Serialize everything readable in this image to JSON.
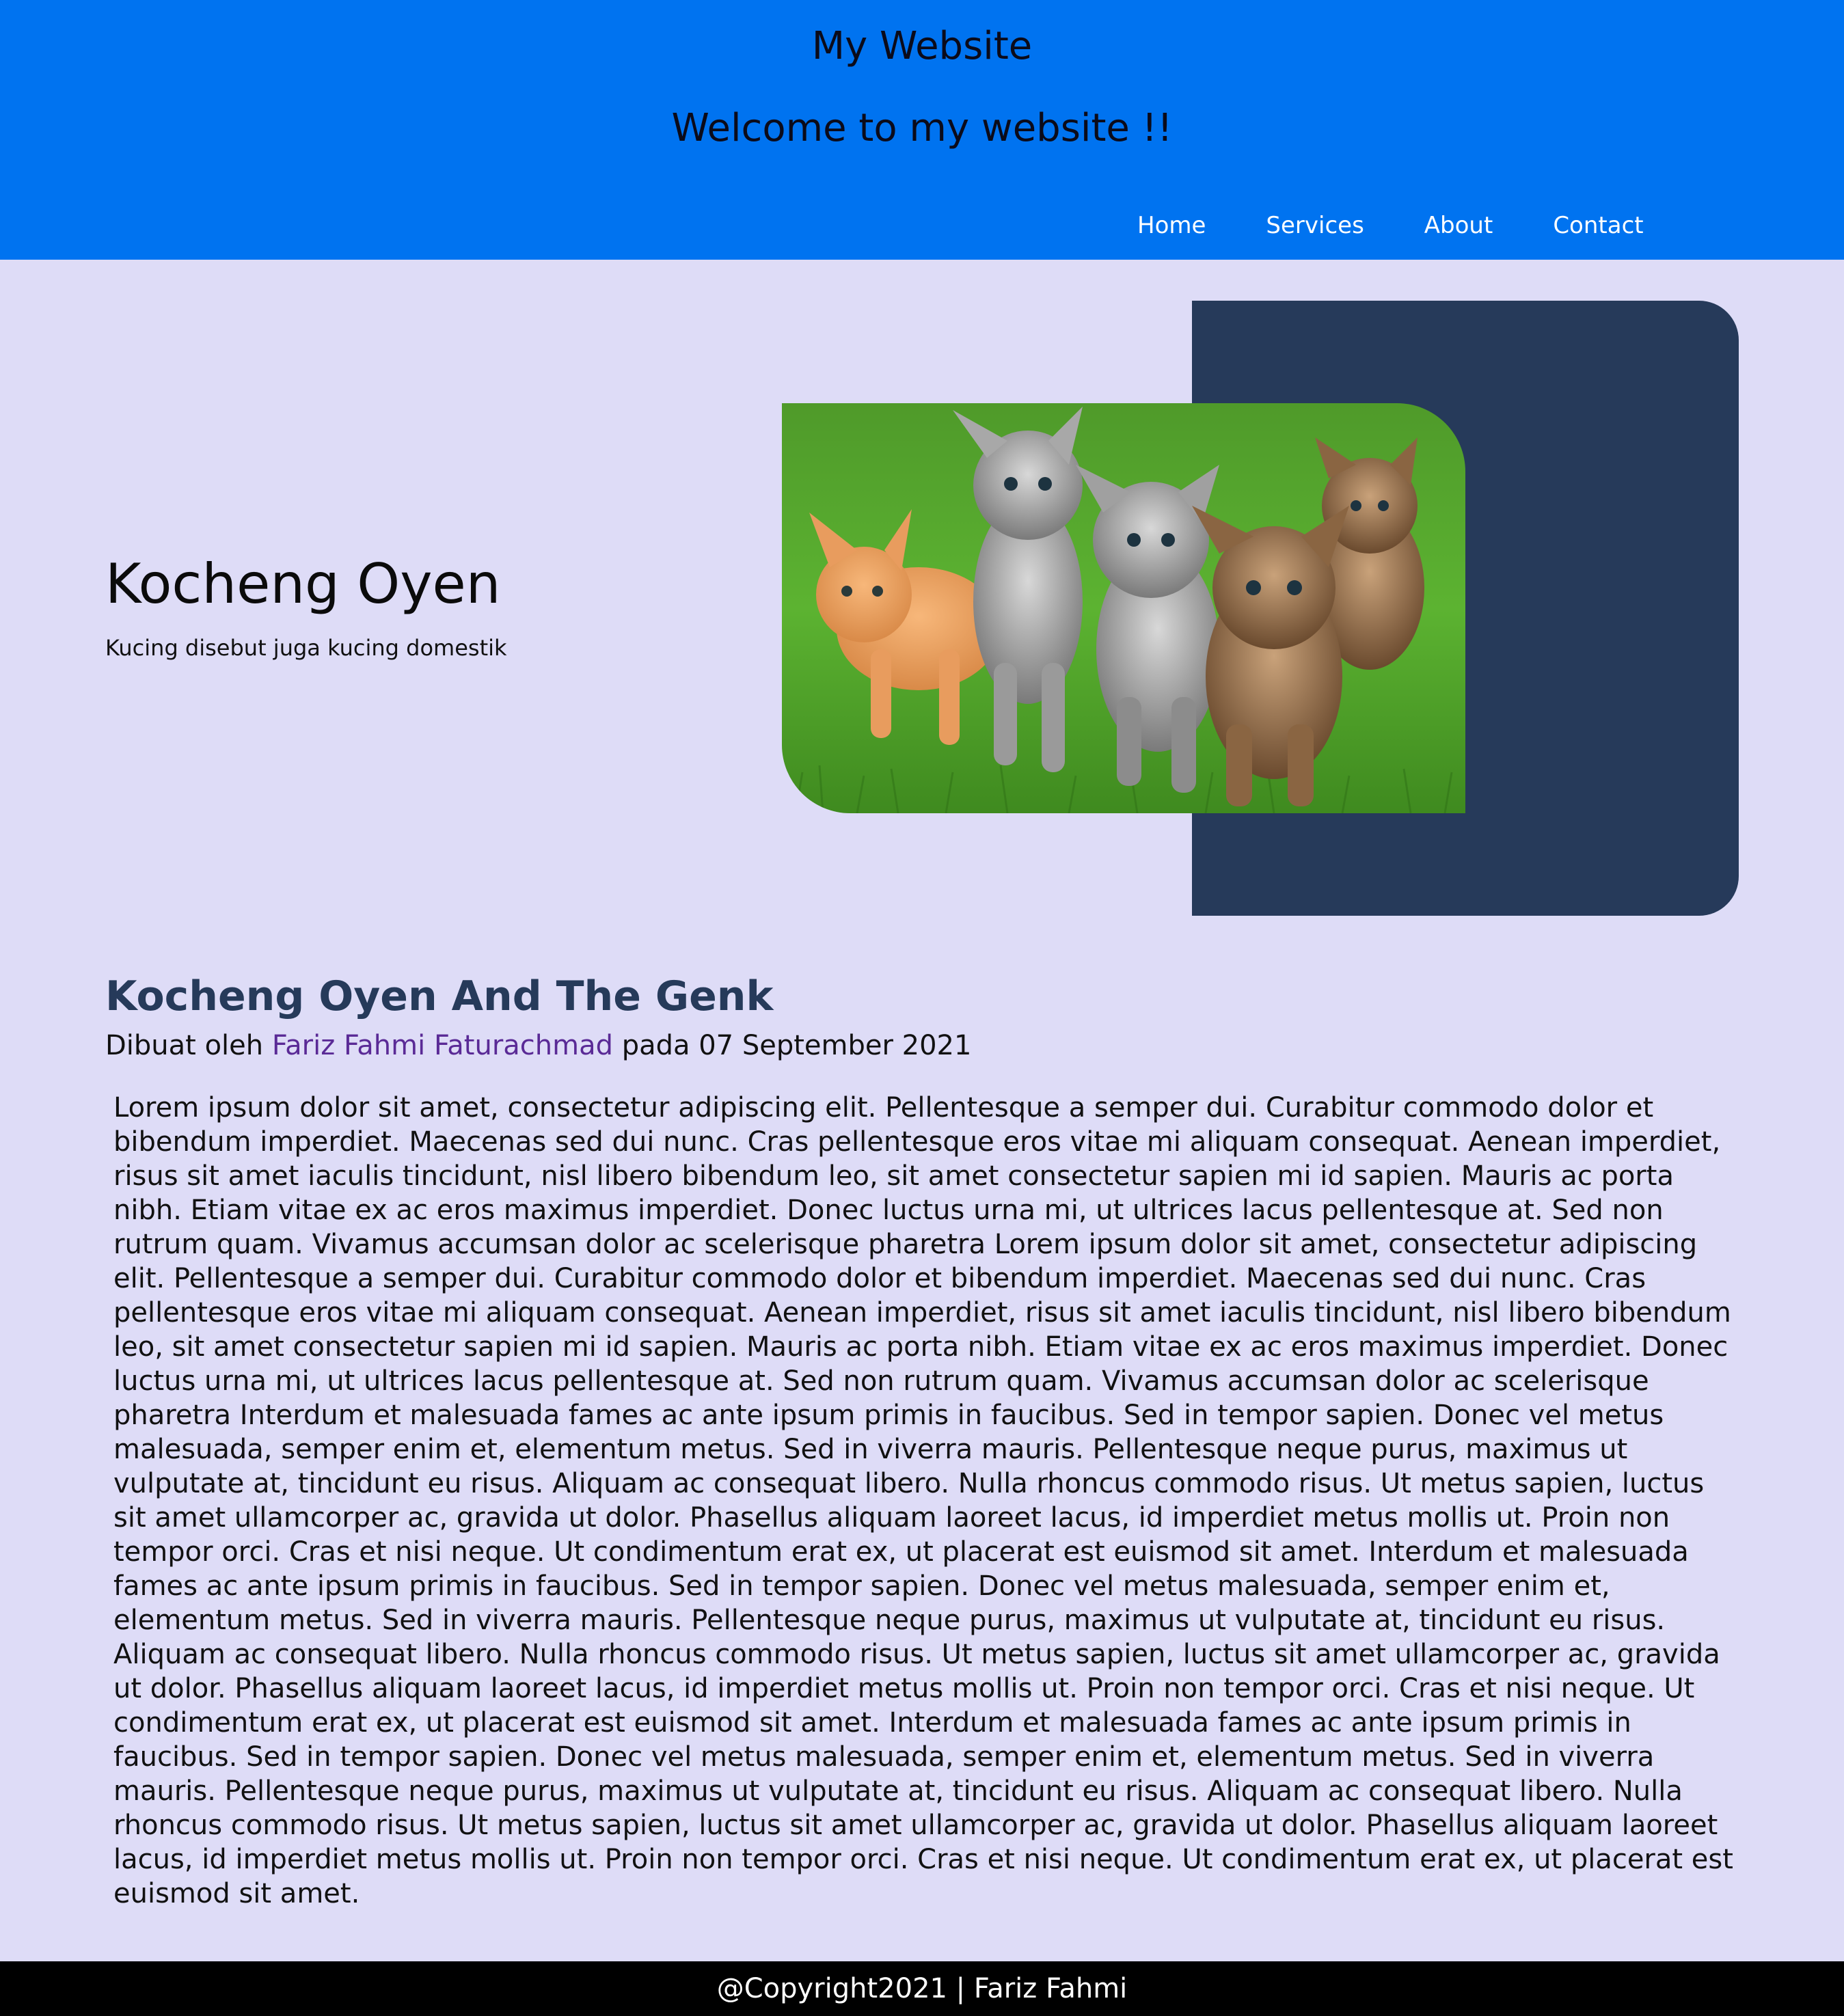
{
  "header": {
    "site_name": "My Website",
    "welcome": "Welcome to my website !!",
    "nav": [
      "Home",
      "Services",
      "About",
      "Contact"
    ],
    "background_color": "#0073f0"
  },
  "hero": {
    "title": "Kocheng Oyen",
    "subtitle": "Kucing disebut juga kucing domestik",
    "image_icon": "kittens-photo",
    "panel_color": "#263a5a"
  },
  "article": {
    "title": "Kocheng Oyen And The Genk",
    "byline_prefix": "Dibuat oleh ",
    "author": "Fariz Fahmi Faturachmad",
    "byline_suffix": " pada 07 September 2021",
    "body": "Lorem ipsum dolor sit amet, consectetur adipiscing elit. Pellentesque a semper dui. Curabitur commodo dolor et bibendum imperdiet. Maecenas sed dui nunc. Cras pellentesque eros vitae mi aliquam consequat. Aenean imperdiet, risus sit amet iaculis tincidunt, nisl libero bibendum leo, sit amet consectetur sapien mi id sapien. Mauris ac porta nibh. Etiam vitae ex ac eros maximus imperdiet. Donec luctus urna mi, ut ultrices lacus pellentesque at. Sed non rutrum quam. Vivamus accumsan dolor ac scelerisque pharetra Lorem ipsum dolor sit amet, consectetur adipiscing elit. Pellentesque a semper dui. Curabitur commodo dolor et bibendum imperdiet. Maecenas sed dui nunc. Cras pellentesque eros vitae mi aliquam consequat. Aenean imperdiet, risus sit amet iaculis tincidunt, nisl libero bibendum leo, sit amet consectetur sapien mi id sapien. Mauris ac porta nibh. Etiam vitae ex ac eros maximus imperdiet. Donec luctus urna mi, ut ultrices lacus pellentesque at. Sed non rutrum quam. Vivamus accumsan dolor ac scelerisque pharetra Interdum et malesuada fames ac ante ipsum primis in faucibus. Sed in tempor sapien. Donec vel metus malesuada, semper enim et, elementum metus. Sed in viverra mauris. Pellentesque neque purus, maximus ut vulputate at, tincidunt eu risus. Aliquam ac consequat libero. Nulla rhoncus commodo risus. Ut metus sapien, luctus sit amet ullamcorper ac, gravida ut dolor. Phasellus aliquam laoreet lacus, id imperdiet metus mollis ut. Proin non tempor orci. Cras et nisi neque. Ut condimentum erat ex, ut placerat est euismod sit amet. Interdum et malesuada fames ac ante ipsum primis in faucibus. Sed in tempor sapien. Donec vel metus malesuada, semper enim et, elementum metus. Sed in viverra mauris. Pellentesque neque purus, maximus ut vulputate at, tincidunt eu risus. Aliquam ac consequat libero. Nulla rhoncus commodo risus. Ut metus sapien, luctus sit amet ullamcorper ac, gravida ut dolor. Phasellus aliquam laoreet lacus, id imperdiet metus mollis ut. Proin non tempor orci. Cras et nisi neque. Ut condimentum erat ex, ut placerat est euismod sit amet. Interdum et malesuada fames ac ante ipsum primis in faucibus. Sed in tempor sapien. Donec vel metus malesuada, semper enim et, elementum metus. Sed in viverra mauris. Pellentesque neque purus, maximus ut vulputate at, tincidunt eu risus. Aliquam ac consequat libero. Nulla rhoncus commodo risus. Ut metus sapien, luctus sit amet ullamcorper ac, gravida ut dolor. Phasellus aliquam laoreet lacus, id imperdiet metus mollis ut. Proin non tempor orci. Cras et nisi neque. Ut condimentum erat ex, ut placerat est euismod sit amet."
  },
  "footer": {
    "text": "@Copyright2021 | Fariz Fahmi"
  }
}
